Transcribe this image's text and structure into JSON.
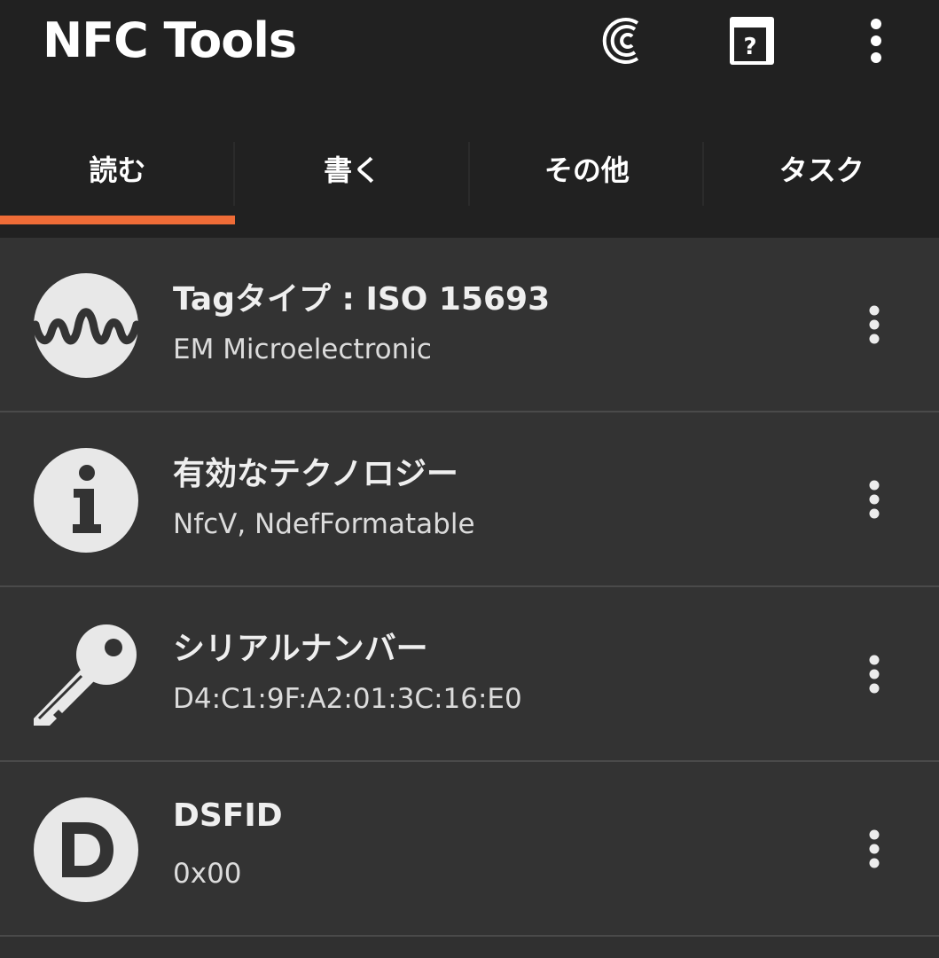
{
  "app": {
    "title": "NFC Tools",
    "accent_color": "#ef6c37",
    "toolbar_icons": [
      "coin-c-icon",
      "help-book-icon",
      "more-vert-icon"
    ]
  },
  "tabs": [
    {
      "label": "読む",
      "selected": true
    },
    {
      "label": "書く",
      "selected": false
    },
    {
      "label": "その他",
      "selected": false
    },
    {
      "label": "タスク",
      "selected": false
    }
  ],
  "rows": [
    {
      "icon": "waveform-icon",
      "title": "Tagタイプ : ISO 15693",
      "subtitle": "EM Microelectronic"
    },
    {
      "icon": "info-icon",
      "title": "有効なテクノロジー",
      "subtitle": "NfcV, NdefFormatable"
    },
    {
      "icon": "key-icon",
      "title": "シリアルナンバー",
      "subtitle": "D4:C1:9F:A2:01:3C:16:E0"
    },
    {
      "icon": "d-letter-icon",
      "title": "DSFID",
      "subtitle": "0x00"
    }
  ]
}
